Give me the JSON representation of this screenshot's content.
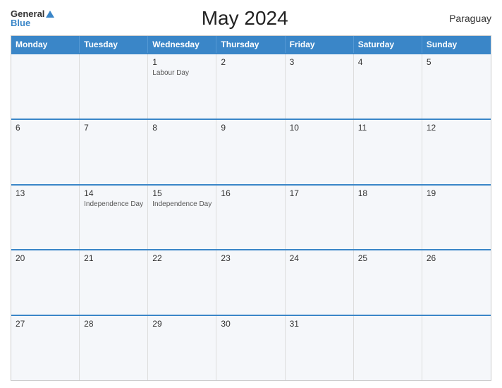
{
  "header": {
    "logo_general": "General",
    "logo_blue": "Blue",
    "title": "May 2024",
    "country": "Paraguay"
  },
  "calendar": {
    "weekdays": [
      "Monday",
      "Tuesday",
      "Wednesday",
      "Thursday",
      "Friday",
      "Saturday",
      "Sunday"
    ],
    "weeks": [
      [
        {
          "date": "",
          "event": ""
        },
        {
          "date": "",
          "event": ""
        },
        {
          "date": "1",
          "event": "Labour Day"
        },
        {
          "date": "2",
          "event": ""
        },
        {
          "date": "3",
          "event": ""
        },
        {
          "date": "4",
          "event": ""
        },
        {
          "date": "5",
          "event": ""
        }
      ],
      [
        {
          "date": "6",
          "event": ""
        },
        {
          "date": "7",
          "event": ""
        },
        {
          "date": "8",
          "event": ""
        },
        {
          "date": "9",
          "event": ""
        },
        {
          "date": "10",
          "event": ""
        },
        {
          "date": "11",
          "event": ""
        },
        {
          "date": "12",
          "event": ""
        }
      ],
      [
        {
          "date": "13",
          "event": ""
        },
        {
          "date": "14",
          "event": "Independence Day"
        },
        {
          "date": "15",
          "event": "Independence Day"
        },
        {
          "date": "16",
          "event": ""
        },
        {
          "date": "17",
          "event": ""
        },
        {
          "date": "18",
          "event": ""
        },
        {
          "date": "19",
          "event": ""
        }
      ],
      [
        {
          "date": "20",
          "event": ""
        },
        {
          "date": "21",
          "event": ""
        },
        {
          "date": "22",
          "event": ""
        },
        {
          "date": "23",
          "event": ""
        },
        {
          "date": "24",
          "event": ""
        },
        {
          "date": "25",
          "event": ""
        },
        {
          "date": "26",
          "event": ""
        }
      ],
      [
        {
          "date": "27",
          "event": ""
        },
        {
          "date": "28",
          "event": ""
        },
        {
          "date": "29",
          "event": ""
        },
        {
          "date": "30",
          "event": ""
        },
        {
          "date": "31",
          "event": ""
        },
        {
          "date": "",
          "event": ""
        },
        {
          "date": "",
          "event": ""
        }
      ]
    ]
  }
}
